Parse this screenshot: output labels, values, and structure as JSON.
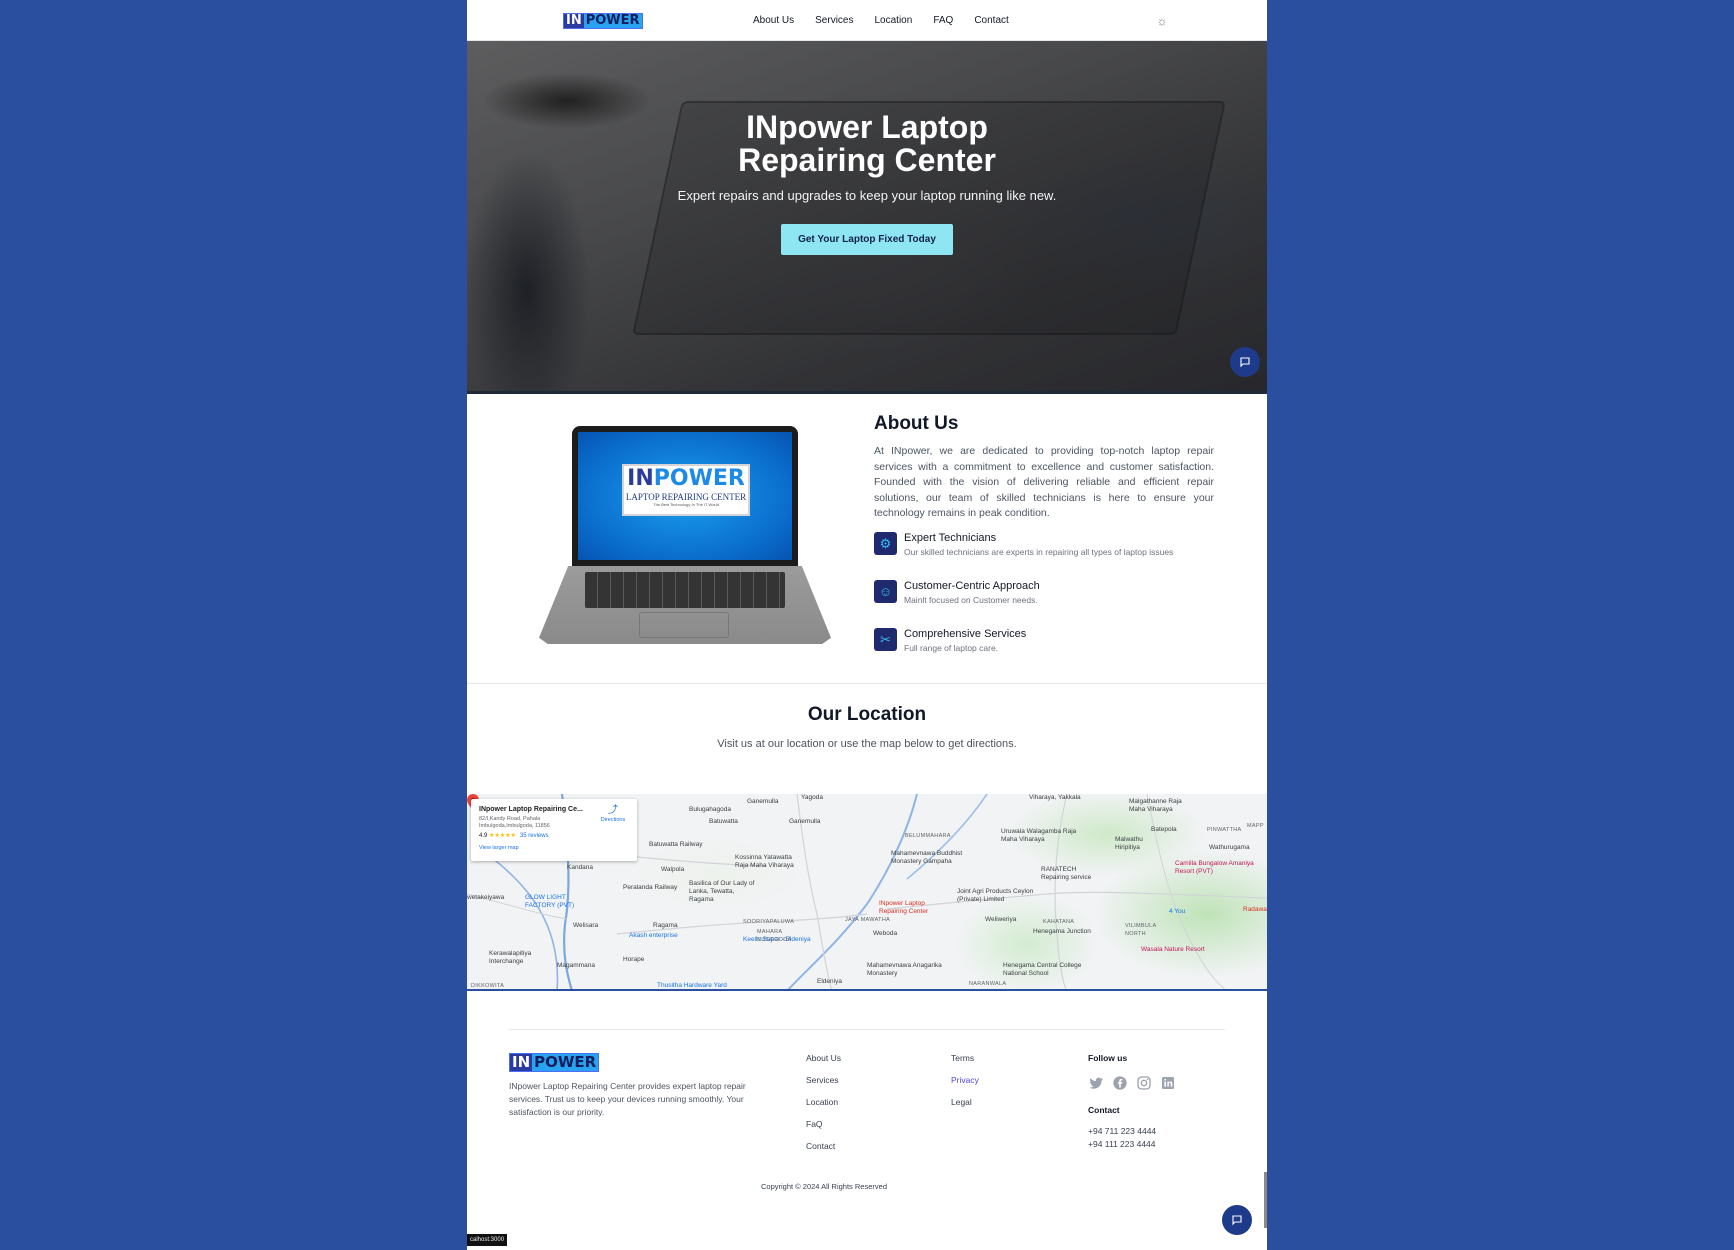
{
  "brand": {
    "logo_in": "IN",
    "logo_power": "POWER"
  },
  "header": {
    "nav": [
      "About Us",
      "Services",
      "Location",
      "FAQ",
      "Contact"
    ],
    "theme_icon": "sun-icon"
  },
  "hero": {
    "title": "INpower Laptop Repairing Center",
    "subtitle": "Expert repairs and upgrades to keep your laptop running like new.",
    "cta": "Get Your Laptop Fixed Today",
    "chat_icon": "chat-icon"
  },
  "about": {
    "laptop_screen": {
      "logo_in": "IN",
      "logo_power": "POWER",
      "tagline": "LAPTOP REPAIRING CENTER",
      "small_text": "The Best Technology In The IT World"
    },
    "title": "About Us",
    "body": "At INpower, we are dedicated to providing top-notch laptop repair services with a commitment to excellence and customer satisfaction. Founded with the vision of delivering reliable and efficient repair solutions, our team of skilled technicians is here to ensure your technology remains in peak condition.",
    "features": [
      {
        "icon": "gear-icon",
        "title": "Expert Technicians",
        "desc": "Our skilled technicians are experts in repairing all types of laptop issues"
      },
      {
        "icon": "smile-icon",
        "title": "Customer-Centric Approach",
        "desc": "Mainlt focused on Customer needs."
      },
      {
        "icon": "tools-icon",
        "title": "Comprehensive Services",
        "desc": "Full range of laptop care."
      }
    ]
  },
  "location": {
    "title": "Our Location",
    "subtitle": "Visit us at our location or use the map below to get directions."
  },
  "map": {
    "card": {
      "name": "INpower Laptop Repairing Ce...",
      "address": "82/I,Kandy Road, Pahala Imbulgoda,Imbulgoda, 11856",
      "rating": "4.9",
      "stars": "★★★★★",
      "reviews": "35 reviews",
      "directions": "Directions",
      "larger_map": "View larger map"
    },
    "marker_label": "INpower Laptop Repairing Center",
    "labels": [
      "Yagoda",
      "Ganemulla",
      "Bulugahagoda",
      "Batuwatta",
      "Ganemulla",
      "Batuwatta Railway",
      "Walpola",
      "Kossinna Yatawatta Raja Maha Viharaya",
      "Kandana",
      "Peralanda Railway",
      "Basilica of Our Lady of Lanka, Tewatta, Ragama",
      "Ragama",
      "Welisara",
      "Akash enterprise",
      "Keells Super - Eldeniya",
      "Horape",
      "Magammana",
      "Thusitha Hardware Yard",
      "Eldeniya",
      "Weboda",
      "JAYA MAWATHA",
      "Mahamevnawa Buddhist Monastery Gampaha",
      "BELUMMAHARA",
      "Uruwala Walagamba Raja Maha Viharaya",
      "Viharaya, Yakkala",
      "Malgathanne Raja Maha Viharaya",
      "Batepola",
      "Malwathu Hiripitiya",
      "Wathurugama",
      "RANATECH Repairing service",
      "Joint Agri Products Ceylon (Private) Limited",
      "Weliweriya",
      "KAHATANA",
      "Henegama Junction",
      "Henegama Central College National School",
      "Mahamevnawa Anagarika Monastery",
      "NARANWALA",
      "Camilla Bungalow Amaniya Resort (PVT)",
      "4 You",
      "Radawana",
      "VILIMBULA NORTH",
      "Wasala Nature Resort",
      "GLOW LIGHT FACTORY (PVT)",
      "Kerawalapitiya Interchange",
      "DIKKOWITA",
      "wetakeiyawa",
      "SOORIYAPALUWA",
      "MAHARA NUGEGODA",
      "PINWATTHA",
      "MAPP"
    ]
  },
  "footer": {
    "description": "INpower Laptop Repairing Center provides expert laptop repair services. Trust us to keep your devices running smoothly. Your satisfaction is our priority.",
    "links_col1": [
      "About Us",
      "Services",
      "Location",
      "FaQ",
      "Contact"
    ],
    "links_col2": [
      "Terms",
      "Privacy",
      "Legal"
    ],
    "follow_title": "Follow us",
    "socials": [
      "twitter-icon",
      "facebook-icon",
      "instagram-icon",
      "linkedin-icon"
    ],
    "contact_title": "Contact",
    "phones": [
      "+94 711 223 4444",
      "+94 111 223 4444"
    ],
    "copyright": "Copyright © 2024 All Rights Reserved"
  },
  "status_url": "calhost:3000",
  "colors": {
    "page_bg": "#2a4f9e",
    "cta_bg": "#8ee6f2",
    "feature_icon_bg": "#1f2a6e",
    "chat_fab": "#1e3a8a",
    "privacy_link": "#4f46e5"
  }
}
